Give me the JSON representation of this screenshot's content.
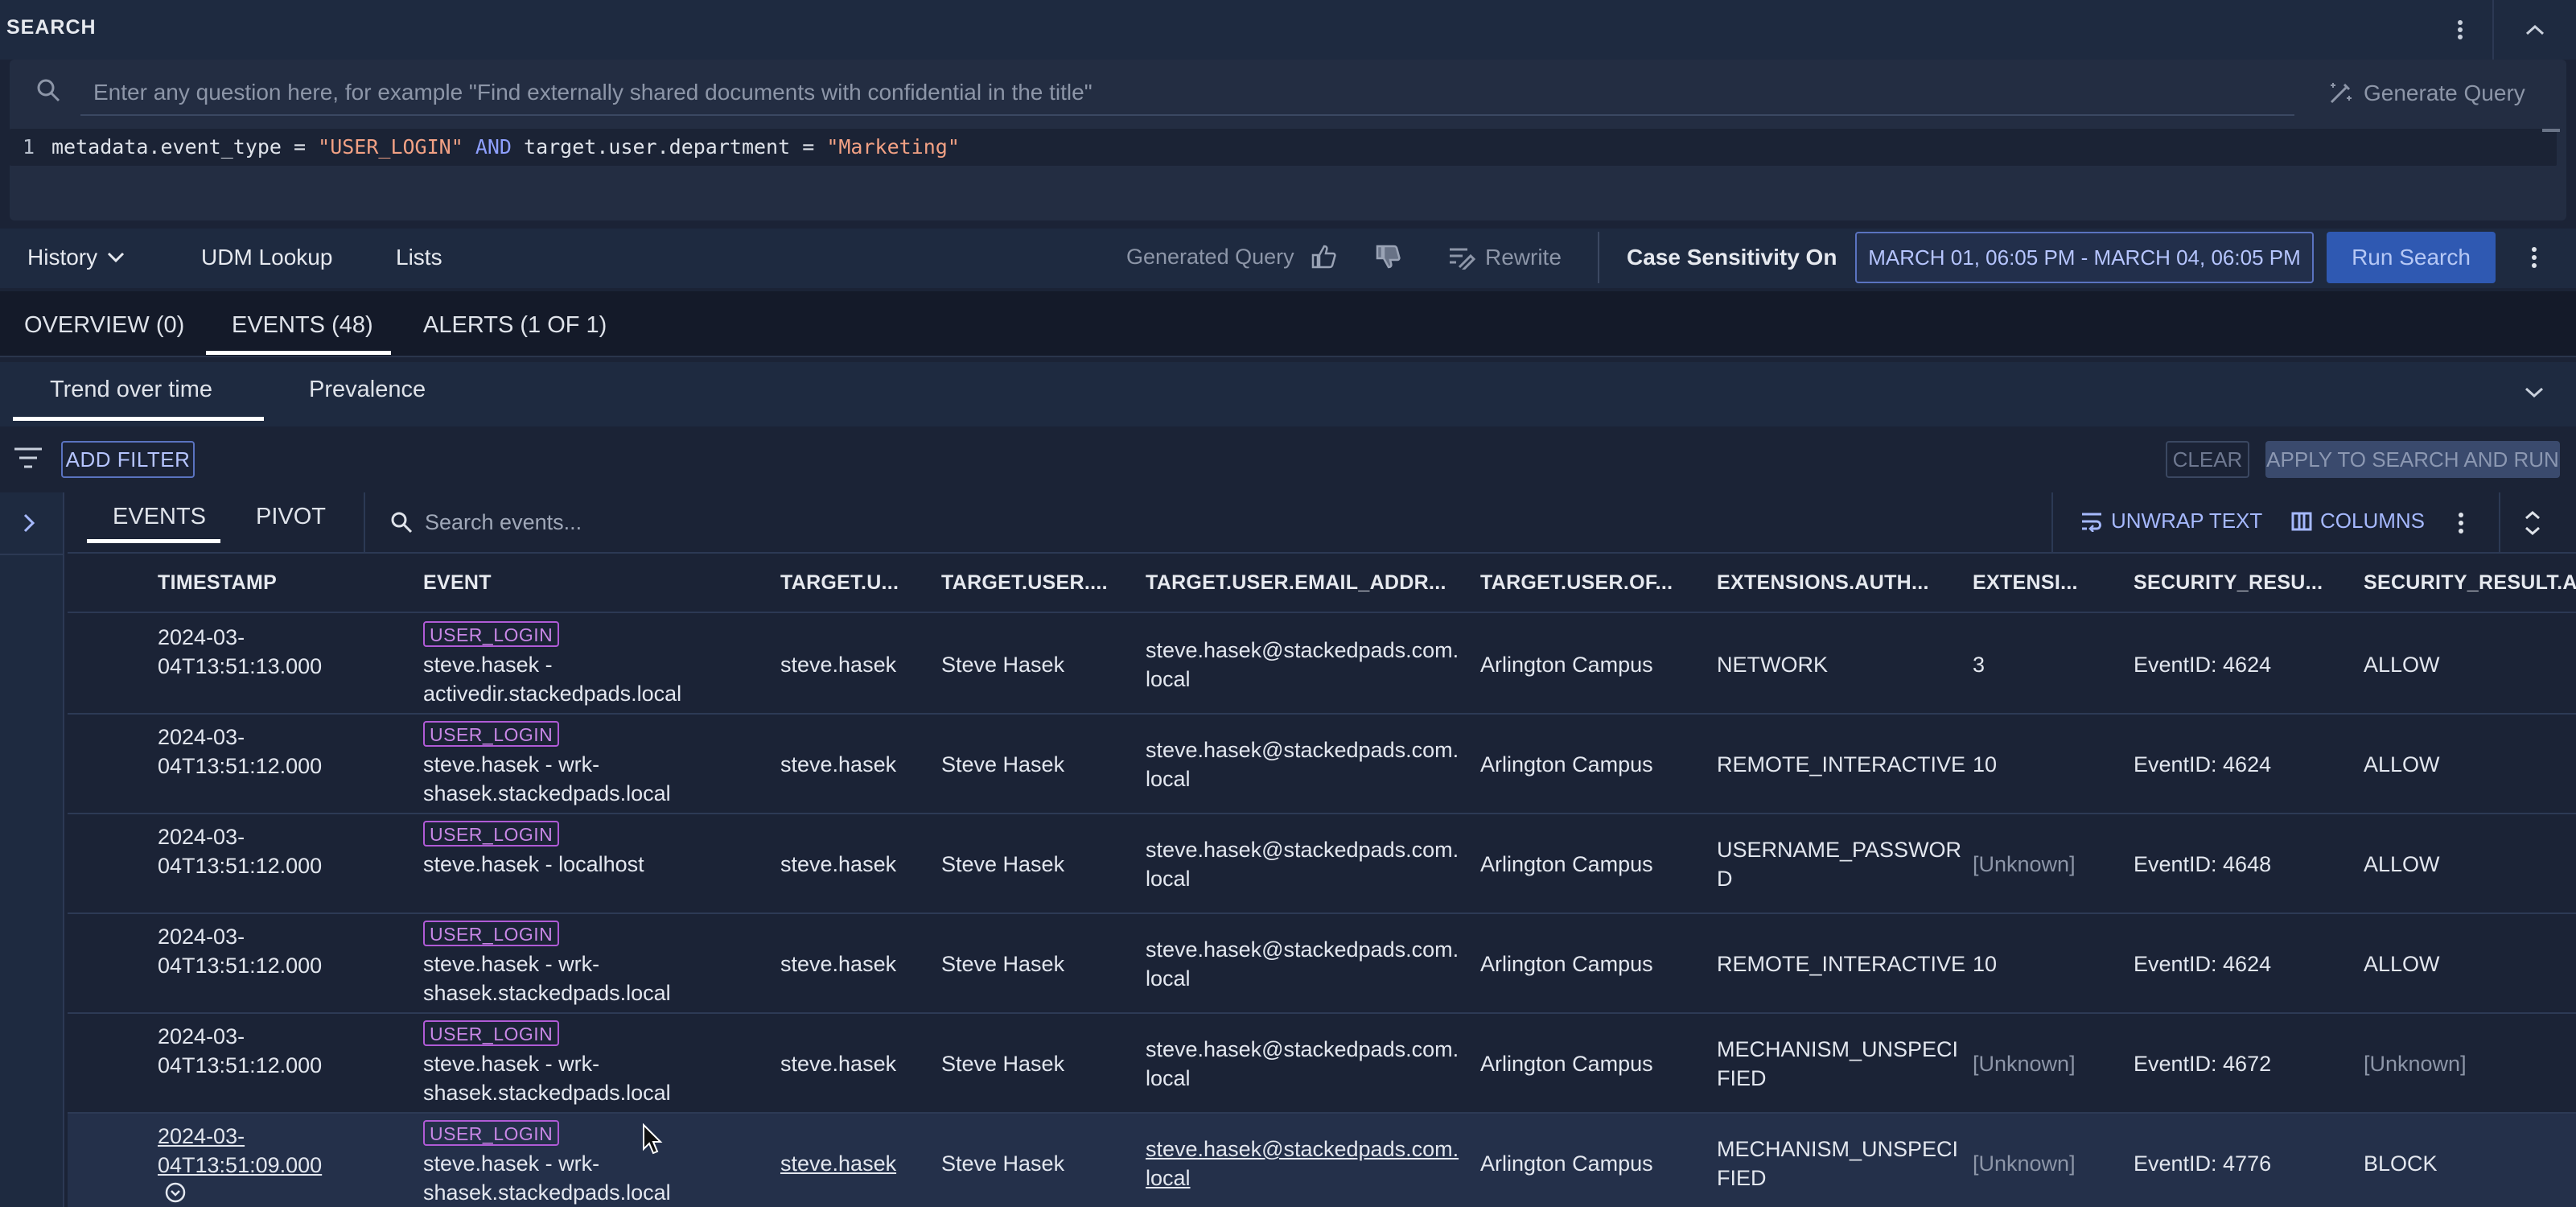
{
  "search_panel": {
    "title": "SEARCH",
    "nl_placeholder": "Enter any question here, for example \"Find externally shared documents with confidential in the title\"",
    "generate_query_label": "Generate Query",
    "editor": {
      "line_number": "1",
      "tokens": {
        "t1": "metadata.event_type",
        "t2": " = ",
        "t3": "\"USER_LOGIN\"",
        "t4": " AND ",
        "t5": "target.user.department",
        "t6": " = ",
        "t7": "\"Marketing\""
      }
    }
  },
  "toolbar": {
    "history_label": "History",
    "udm_lookup_label": "UDM Lookup",
    "lists_label": "Lists",
    "generated_query_label": "Generated Query",
    "rewrite_label": "Rewrite",
    "case_sensitivity_label": "Case Sensitivity On",
    "date_range": "MARCH 01, 06:05 PM - MARCH 04, 06:05 PM",
    "run_search_label": "Run Search"
  },
  "main_tabs": {
    "overview": "OVERVIEW (0)",
    "events": "EVENTS (48)",
    "alerts": "ALERTS (1 OF 1)"
  },
  "sub_tabs": {
    "trend": "Trend over time",
    "prevalence": "Prevalence"
  },
  "filter_bar": {
    "add_filter": "ADD FILTER",
    "clear": "CLEAR",
    "apply": "APPLY TO SEARCH AND RUN"
  },
  "results": {
    "tabs": {
      "events": "EVENTS",
      "pivot": "PIVOT"
    },
    "search_placeholder": "Search events...",
    "unwrap_text": "UNWRAP TEXT",
    "columns": "COLUMNS",
    "headers": {
      "timestamp": "TIMESTAMP",
      "event": "EVENT",
      "target_u": "TARGET.U...",
      "target_user": "TARGET.USER....",
      "email": "TARGET.USER.EMAIL_ADDR...",
      "office": "TARGET.USER.OF...",
      "ext_auth": "EXTENSIONS.AUTH...",
      "extensi": "EXTENSI...",
      "sec_result": "SECURITY_RESU...",
      "sec_action": "SECURITY_RESULT.AC"
    },
    "rows": [
      {
        "ts1": "2024-03-",
        "ts2": "04T13:51:13.000",
        "badge": "USER_LOGIN",
        "ev1": "steve.hasek -",
        "ev2": "activedir.stackedpads.local",
        "user": "steve.hasek",
        "name": "Steve Hasek",
        "email1": "steve.hasek@stackedpads.com.",
        "email2": "local",
        "office": "Arlington Campus",
        "auth1": "NETWORK",
        "auth2": "",
        "ext": "3",
        "sec": "EventID: 4624",
        "action": "ALLOW"
      },
      {
        "ts1": "2024-03-",
        "ts2": "04T13:51:12.000",
        "badge": "USER_LOGIN",
        "ev1": "steve.hasek - wrk-",
        "ev2": "shasek.stackedpads.local",
        "user": "steve.hasek",
        "name": "Steve Hasek",
        "email1": "steve.hasek@stackedpads.com.",
        "email2": "local",
        "office": "Arlington Campus",
        "auth1": "REMOTE_INTERACTIVE",
        "auth2": "",
        "ext": "10",
        "sec": "EventID: 4624",
        "action": "ALLOW"
      },
      {
        "ts1": "2024-03-",
        "ts2": "04T13:51:12.000",
        "badge": "USER_LOGIN",
        "ev1": "steve.hasek - localhost",
        "ev2": "",
        "user": "steve.hasek",
        "name": "Steve Hasek",
        "email1": "steve.hasek@stackedpads.com.",
        "email2": "local",
        "office": "Arlington Campus",
        "auth1": "USERNAME_PASSWOR",
        "auth2": "D",
        "ext": "[Unknown]",
        "sec": "EventID: 4648",
        "action": "ALLOW"
      },
      {
        "ts1": "2024-03-",
        "ts2": "04T13:51:12.000",
        "badge": "USER_LOGIN",
        "ev1": "steve.hasek - wrk-",
        "ev2": "shasek.stackedpads.local",
        "user": "steve.hasek",
        "name": "Steve Hasek",
        "email1": "steve.hasek@stackedpads.com.",
        "email2": "local",
        "office": "Arlington Campus",
        "auth1": "REMOTE_INTERACTIVE",
        "auth2": "",
        "ext": "10",
        "sec": "EventID: 4624",
        "action": "ALLOW"
      },
      {
        "ts1": "2024-03-",
        "ts2": "04T13:51:12.000",
        "badge": "USER_LOGIN",
        "ev1": "steve.hasek - wrk-",
        "ev2": "shasek.stackedpads.local",
        "user": "steve.hasek",
        "name": "Steve Hasek",
        "email1": "steve.hasek@stackedpads.com.",
        "email2": "local",
        "office": "Arlington Campus",
        "auth1": "MECHANISM_UNSPECI",
        "auth2": "FIED",
        "ext": "[Unknown]",
        "sec": "EventID: 4672",
        "action": "[Unknown]"
      },
      {
        "ts1": "2024-03-",
        "ts2": "04T13:51:09.000",
        "badge": "USER_LOGIN",
        "ev1": "steve.hasek - wrk-",
        "ev2": "shasek.stackedpads.local",
        "user": "steve.hasek",
        "name": "Steve Hasek",
        "email1": "steve.hasek@stackedpads.com.",
        "email2": "local",
        "office": "Arlington Campus",
        "auth1": "MECHANISM_UNSPECI",
        "auth2": "FIED",
        "ext": "[Unknown]",
        "sec": "EventID: 4776",
        "action": "BLOCK"
      }
    ]
  },
  "colors": {
    "background": "#1b2336",
    "panel": "#1e2a40",
    "accent": "#5a73c0",
    "run_button": "#2f59b2",
    "badge": "#b05bd6",
    "string_token": "#f2a184",
    "keyword_token": "#8ea0ff"
  },
  "icons": [
    "search-icon",
    "generate-query-icon",
    "more-vert-icon",
    "chevron-up-icon",
    "chevron-down-icon",
    "thumb-up-icon",
    "thumb-down-icon",
    "rewrite-icon",
    "filter-icon",
    "chevron-right-icon",
    "unwrap-icon",
    "columns-icon",
    "expand-vertical-icon",
    "expand-row-icon",
    "mouse-cursor-icon"
  ]
}
